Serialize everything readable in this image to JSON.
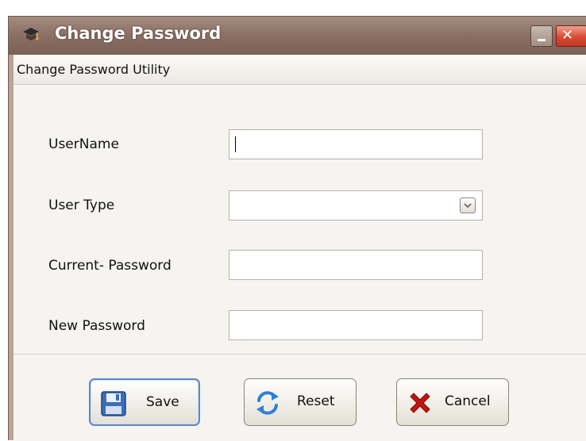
{
  "window": {
    "title": "Change Password",
    "minimize_icon": "minimize-icon",
    "close_glyph": "✕",
    "close_icon": "close-icon"
  },
  "header": {
    "utility_title": "Change Password Utility"
  },
  "form": {
    "username": {
      "label": "UserName",
      "value": ""
    },
    "user_type": {
      "label": "User Type",
      "selected": ""
    },
    "current_password": {
      "label": "Current- Password",
      "value": ""
    },
    "new_password": {
      "label": "New Password",
      "value": ""
    }
  },
  "buttons": {
    "save": {
      "label": "Save",
      "icon": "floppy-disk-icon"
    },
    "reset": {
      "label": "Reset",
      "icon": "refresh-icon"
    },
    "cancel": {
      "label": "Cancel",
      "icon": "red-x-icon"
    }
  },
  "colors": {
    "titlebar": "#8c7266",
    "close_button": "#d84a34",
    "focus_border": "#5d87c2",
    "save_icon": "#3a6fb7",
    "reset_icon": "#2f7fd6",
    "cancel_icon": "#c3140f"
  }
}
